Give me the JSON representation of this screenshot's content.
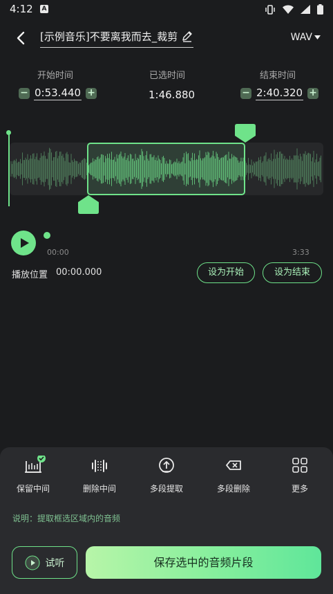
{
  "status": {
    "time": "4:12",
    "notif": "A"
  },
  "header": {
    "title": "[示例音乐]不要离我而去_裁剪",
    "format": "WAV"
  },
  "times": {
    "start_label": "开始时间",
    "selected_label": "已选时间",
    "end_label": "结束时间",
    "start_value": "0:53.440",
    "selected_value": "1:46.880",
    "end_value": "2:40.320",
    "minus": "−",
    "plus": "+"
  },
  "player": {
    "current": "00:00",
    "total": "3:33",
    "position_label": "播放位置",
    "position_value": "00:00.000",
    "set_start": "设为开始",
    "set_end": "设为结束"
  },
  "tools": [
    {
      "label": "保留中间",
      "icon": "keep-middle-icon"
    },
    {
      "label": "删除中间",
      "icon": "delete-middle-icon"
    },
    {
      "label": "多段提取",
      "icon": "multi-extract-icon"
    },
    {
      "label": "多段删除",
      "icon": "multi-delete-icon"
    },
    {
      "label": "更多",
      "icon": "more-grid-icon"
    }
  ],
  "note": "说明：提取框选区域内的音频",
  "actions": {
    "preview": "试听",
    "save": "保存选中的音频片段"
  },
  "colors": {
    "accent": "#6fe38a",
    "background": "#1b1c1e",
    "panel": "#2a2b2e"
  }
}
